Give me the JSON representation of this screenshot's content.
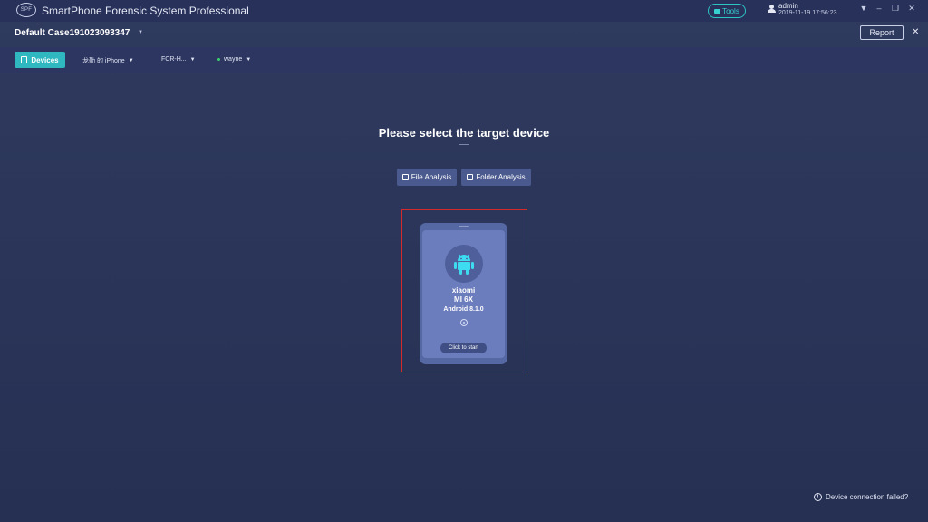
{
  "app": {
    "logo_text": "SPF",
    "title": "SmartPhone Forensic System Professional"
  },
  "titlebar": {
    "tools_label": "Tools",
    "user_name": "admin",
    "user_time": "2019-11-19 17:56:23",
    "menu_glyph": "▼",
    "minimize_glyph": "–",
    "restore_glyph": "❐",
    "close_glyph": "✕"
  },
  "case": {
    "title": "Default Case191023093347",
    "arrow": "▼",
    "report_label": "Report",
    "close_glyph": "✕"
  },
  "toolbar": {
    "devices_label": "Devices",
    "dropdowns": [
      {
        "label": "龙勤 的 iPhone",
        "caret": "▼"
      },
      {
        "label": "FCR-H...",
        "caret": "▼"
      },
      {
        "label": "wayne",
        "caret": "▼"
      }
    ]
  },
  "main": {
    "prompt": "Please select the target device",
    "file_analysis_label": "File Analysis",
    "folder_analysis_label": "Folder Analysis"
  },
  "device": {
    "brand": "xiaomi",
    "model": "MI 6X",
    "os": "Android 8.1.0",
    "start_label": "Click to start"
  },
  "footer": {
    "connection_failed": "Device connection failed?",
    "info_glyph": "!"
  },
  "colors": {
    "accent": "#2fb8c0",
    "android_green": "#3ddcf0",
    "highlight": "#d32b2b"
  }
}
